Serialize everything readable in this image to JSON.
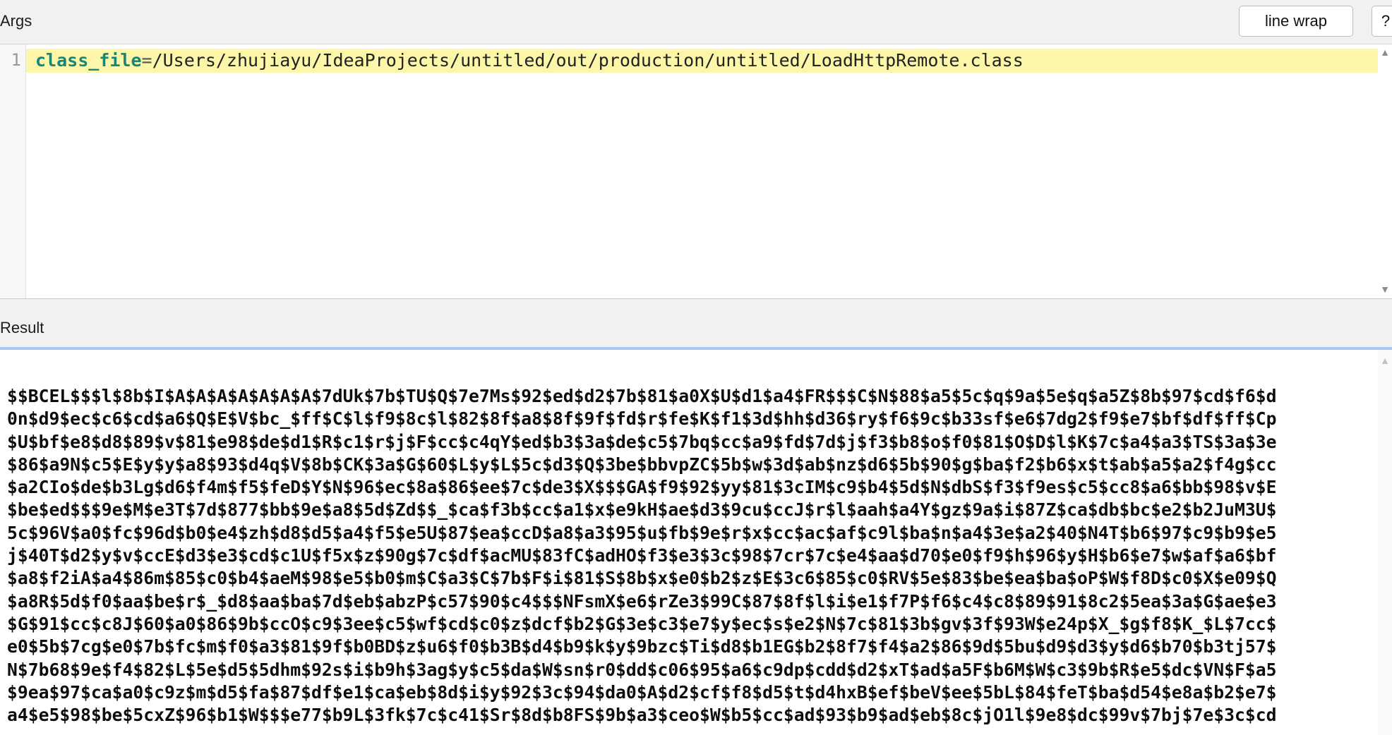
{
  "args": {
    "title": "Args",
    "line_wrap_button": "line wrap",
    "help_button": "?",
    "line_number": "1",
    "code_key": "class_file",
    "code_eq": "=",
    "code_value": "/Users/zhujiayu/IdeaProjects/untitled/out/production/untitled/LoadHttpRemote.class"
  },
  "result": {
    "title": "Result",
    "lines": [
      "$$BCEL$$$l$8b$I$A$A$A$A$A$A$A$7dUk$7b$TU$Q$7e7Ms$92$ed$d2$7b$81$a0X$U$d1$a4$FR$$$C$N$88$a5$5c$q$9a$5e$q$a5Z$8b$97$cd$f6$d",
      "0n$d9$ec$c6$cd$a6$Q$E$V$bc_$ff$C$l$f9$8c$l$82$8f$a8$8f$9f$fd$r$fe$K$f1$3d$hh$d36$ry$f6$9c$b33sf$e6$7dg2$f9$e7$bf$df$ff$Cp",
      "$U$bf$e8$d8$89$v$81$e98$de$d1$R$c1$r$j$F$cc$c4qY$ed$b3$3a$de$c5$7bq$cc$a9$fd$7d$j$f3$b8$o$f0$81$O$D$l$K$7c$a4$a3$TS$3a$3e",
      "$86$a9N$c5$E$y$y$a8$93$d4q$V$8b$CK$3a$G$60$L$y$L$5c$d3$Q$3be$bbvpZC$5b$w$3d$ab$nz$d6$5b$90$g$ba$f2$b6$x$t$ab$a5$a2$f4g$cc",
      "$a2CIo$de$b3Lg$d6$f4m$f5$feD$Y$N$96$ec$8a$86$ee$7c$de3$X$$$GA$f9$92$yy$81$3cIM$c9$b4$5d$N$dbS$f3$f9es$c5$cc8$a6$bb$98$v$E",
      "$be$ed$$$9e$M$e3T$7d$877$bb$9e$a8$5d$Zd$$_$ca$f3b$cc$a1$x$e9kH$ae$d3$9cu$ccJ$r$l$aah$a4Y$gz$9a$i$87Z$ca$db$bc$e2$b2JuM3U$",
      "5c$96V$a0$fc$96d$b0$e4$zh$d8$d5$a4$f5$e5U$87$ea$ccD$a8$a3$95$u$fb$9e$r$x$cc$ac$af$c9l$ba$n$a4$3e$a2$40$N4T$b6$97$c9$b9$e5",
      "j$40T$d2$y$v$ccE$d3$e3$cd$c1U$f5x$z$90g$7c$df$acMU$83fC$adHO$f3$e3$3c$98$7cr$7c$e4$aa$d70$e0$f9$h$96$y$H$b6$e7$w$af$a6$bf",
      "$a8$f2iA$a4$86m$85$c0$b4$aeM$98$e5$b0$m$C$a3$C$7b$F$i$81$S$8b$x$e0$b2$z$E$3c6$85$c0$RV$5e$83$be$ea$ba$oP$W$f8D$c0$X$e09$Q",
      "$a8R$5d$f0$aa$be$r$_$d8$aa$ba$7d$eb$abzP$c57$90$c4$$$NFsmX$e6$rZe3$99C$87$8f$l$i$e1$f7P$f6$c4$c8$89$91$8c2$5ea$3a$G$ae$e3",
      "$G$91$cc$c8J$60$a0$86$9b$ccO$c9$3ee$c5$wf$cd$c0$z$dcf$b2$G$3e$c3$e7$y$ec$s$e2$N$7c$81$3b$gv$3f$93W$e24p$X_$g$f8$K_$L$7cc$",
      "e0$5b$7cg$e0$7b$fc$m$f0$a3$81$9f$b0BD$z$u6$f0$b3B$d4$b9$k$y$9bzc$Ti$d8$b1EG$b2$8f7$f4$a2$86$9d$5bu$d9$d3$y$d6$b70$b3tj57$",
      "N$7b68$9e$f4$82$L$5e$d5$5dhm$92s$i$b9h$3ag$y$c5$da$W$sn$r0$dd$c06$95$a6$c9dp$cdd$d2$xT$ad$a5F$b6M$W$c3$9b$R$e5$dc$VN$F$a5",
      "$9ea$97$ca$a0$c9z$m$d5$fa$87$df$e1$ca$eb$8d$i$y$92$3c$94$da0$A$d2$cf$f8$d5$t$d4hxB$ef$beV$ee$5bL$84$feT$ba$d54$e8a$b2$e7$",
      "a4$e5$98$be$5cxZ$96$b1$W$$$e77$b9L$3fk$7c$c41$Sr$8d$b8FS$9b$a3$ceo$W$b5$cc$ad$93$b9$ad$eb$8c$jO1l$9e8$dc$99v$7bj$7e$3c$cd"
    ]
  },
  "icons": {
    "scroll_up": "▲",
    "scroll_down": "▼"
  }
}
